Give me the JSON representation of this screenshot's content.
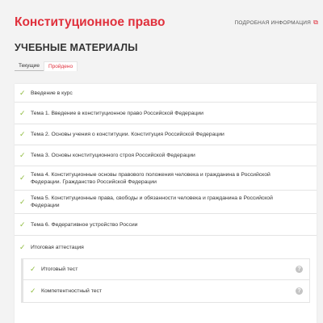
{
  "header": {
    "course_title": "Конституционное право",
    "more_info": "ПОДРОБНАЯ ИНФОРМАЦИЯ"
  },
  "section_title": "УЧЕБНЫЕ МАТЕРИАЛЫ",
  "tabs": [
    {
      "label": "Текущие",
      "active": false
    },
    {
      "label": "Пройдено",
      "active": true
    }
  ],
  "colors": {
    "accent": "#e0303c",
    "check": "#8dbb3c"
  },
  "icons": {
    "row_status": "check-icon",
    "external": "external-link-icon",
    "help": "help-icon"
  },
  "items": [
    {
      "label": "Введение в курс"
    },
    {
      "label": "Тема 1. Введение в конституционное право Российской Федерации"
    },
    {
      "label": "Тема 2. Основы учения о конституции. Конституция Российской Федерации"
    },
    {
      "label": "Тема 3. Основы конституционного строя Российской Федерации"
    },
    {
      "label": "Тема 4. Конституционные основы правового положения человека и гражданина в Российской Федерации. Гражданство Российской Федерации"
    },
    {
      "label": "Тема 5. Конституционные права, свободы и обязанности человека и гражданина в Российской Федерации"
    },
    {
      "label": "Тема 6. Федеративное устройство России"
    },
    {
      "label": "Итоговая аттестация"
    }
  ],
  "sub_items": [
    {
      "label": "Итоговый тест"
    },
    {
      "label": "Компетентностный тест"
    }
  ]
}
